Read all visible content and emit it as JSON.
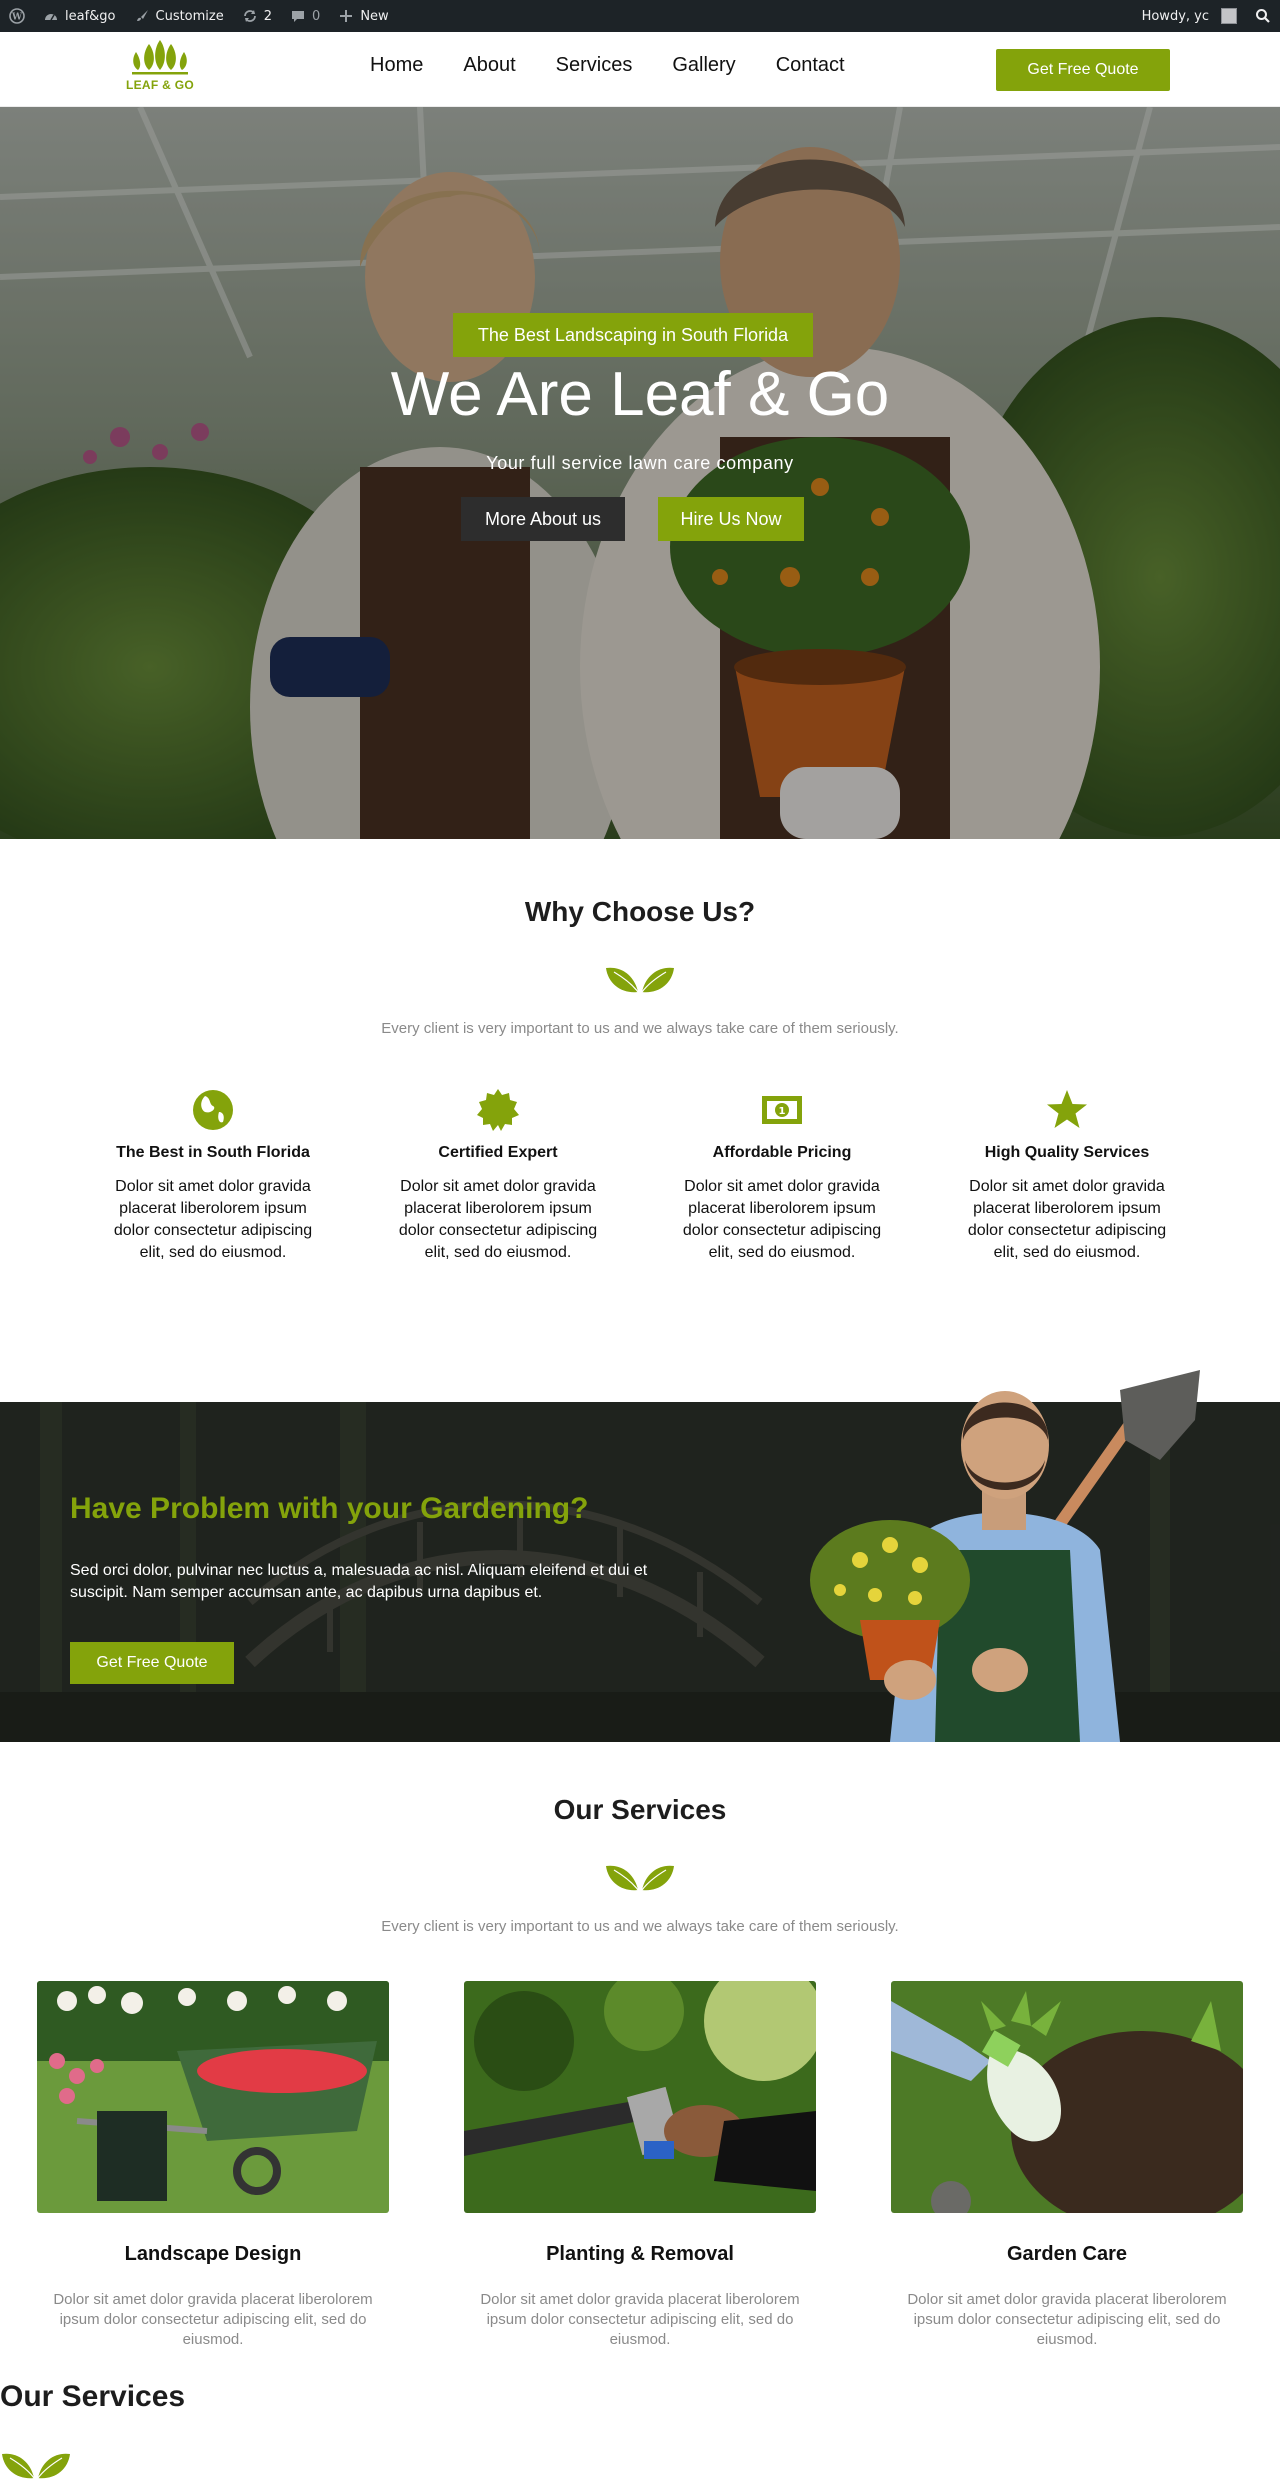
{
  "admin_bar": {
    "site_name": "leaf&go",
    "customize": "Customize",
    "updates_count": "2",
    "comments_count": "0",
    "new_label": "New",
    "howdy": "Howdy, yc"
  },
  "header": {
    "logo_text": "LEAF & GO",
    "nav": [
      "Home",
      "About",
      "Services",
      "Gallery",
      "Contact"
    ],
    "cta": "Get Free Quote"
  },
  "hero": {
    "tag": "The Best Landscaping in South Florida",
    "title": "We Are Leaf & Go",
    "subtitle": "Your full service lawn care company",
    "btn_more": "More About us",
    "btn_hire": "Hire Us Now"
  },
  "why": {
    "title": "Why Choose Us?",
    "subtitle": "Every client is very important to us and we always take care of them seriously.",
    "features": [
      {
        "icon": "globe-icon",
        "title": "The Best in South Florida",
        "text": "Dolor sit amet dolor gravida placerat liberolorem ipsum dolor consectetur adipiscing elit, sed do eiusmod."
      },
      {
        "icon": "certificate-icon",
        "title": "Certified Expert",
        "text": "Dolor sit amet dolor gravida placerat liberolorem ipsum dolor consectetur adipiscing elit, sed do eiusmod."
      },
      {
        "icon": "money-icon",
        "title": "Affordable Pricing",
        "text": "Dolor sit amet dolor gravida placerat liberolorem ipsum dolor consectetur adipiscing elit, sed do eiusmod."
      },
      {
        "icon": "star-icon",
        "title": "High Quality Services",
        "text": "Dolor sit amet dolor gravida placerat liberolorem ipsum dolor consectetur adipiscing elit, sed do eiusmod."
      }
    ]
  },
  "problem": {
    "title": "Have Problem with your Gardening?",
    "text": "Sed orci dolor, pulvinar nec luctus a, malesuada ac nisl. Aliquam eleifend et dui et suscipit. Nam semper accumsan ante, ac dapibus urna dapibus et.",
    "cta": "Get Free Quote"
  },
  "services": {
    "title": "Our Services",
    "subtitle": "Every client is very important to us and we always take care of them seriously.",
    "items": [
      {
        "title": "Landscape Design",
        "text": "Dolor sit amet dolor gravida placerat liberolorem ipsum dolor consectetur adipiscing elit, sed do eiusmod."
      },
      {
        "title": "Planting & Removal",
        "text": "Dolor sit amet dolor gravida placerat liberolorem ipsum dolor consectetur adipiscing elit, sed do eiusmod."
      },
      {
        "title": "Garden Care",
        "text": "Dolor sit amet dolor gravida placerat liberolorem ipsum dolor consectetur adipiscing elit, sed do eiusmod."
      }
    ],
    "repeat_title": "Our Services"
  },
  "colors": {
    "brand_green": "#84a30b",
    "admin_bar": "#1d2327",
    "dark_button": "#2d2d2d"
  }
}
